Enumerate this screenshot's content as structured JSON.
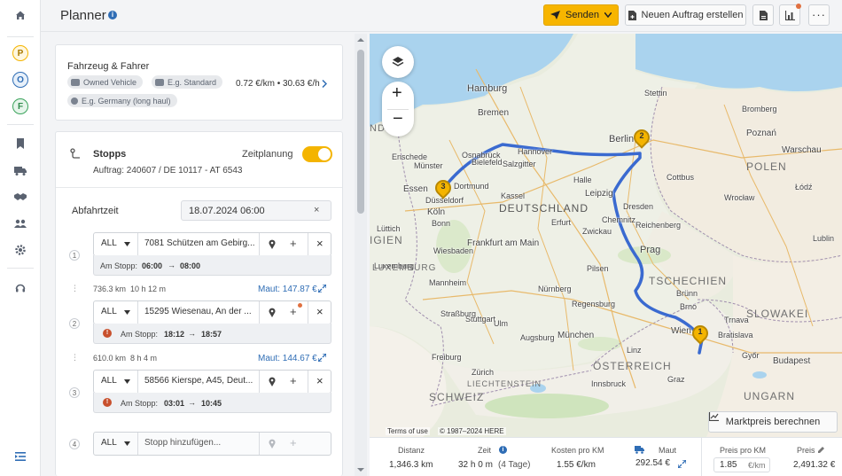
{
  "header": {
    "title": "Planner",
    "send_label": "Senden",
    "new_order_label": "Neuen Auftrag erstellen"
  },
  "rail": {
    "badges": [
      {
        "letter": "P",
        "color": "#f4b400"
      },
      {
        "letter": "O",
        "color": "#2f6db5"
      },
      {
        "letter": "F",
        "color": "#3aa35b"
      }
    ]
  },
  "vehicle": {
    "title": "Fahrzeug & Fahrer",
    "chips": [
      "Owned Vehicle",
      "E.g. Standard",
      "E.g. Germany (long haul)"
    ],
    "rate": "0.72 €/km • 30.63 €/h"
  },
  "stops": {
    "title": "Stopps",
    "order_ref": "Auftrag: 240607 / DE 10117 - AT 6543",
    "time_planning_label": "Zeitplanung",
    "departure_label": "Abfahrtzeit",
    "departure_value": "18.07.2024 06:00",
    "items": [
      {
        "num": "1",
        "filter": "ALL",
        "address": "7081 Schützen am Gebirg...",
        "at_stop_label": "Am Stopp:",
        "from": "06:00",
        "to": "08:00",
        "warning": false
      },
      {
        "num": "2",
        "filter": "ALL",
        "address": "15295 Wiesenau, An der ...",
        "at_stop_label": "Am Stopp:",
        "from": "18:12",
        "to": "18:57",
        "warning": true
      },
      {
        "num": "3",
        "filter": "ALL",
        "address": "58566 Kierspe, A45, Deut...",
        "at_stop_label": "Am Stopp:",
        "from": "03:01",
        "to": "10:45",
        "warning": true
      },
      {
        "num": "4",
        "filter": "ALL",
        "address": "Stopp hinzufügen..."
      }
    ],
    "legs": [
      {
        "distance": "736.3 km",
        "duration": "10 h 12 m",
        "toll": "Maut: 147.87 €"
      },
      {
        "distance": "610.0 km",
        "duration": "8 h 4 m",
        "toll": "Maut: 144.67 €"
      }
    ]
  },
  "map": {
    "cities": [
      "Hamburg",
      "Bremen",
      "Berlin",
      "Stettin",
      "Hannover",
      "Bielefeld",
      "Dortmund",
      "Essen",
      "Köln",
      "Düsseldorf",
      "Bonn",
      "Münster",
      "Osnabrück",
      "Enschede",
      "Kassel",
      "Leipzig",
      "Dresden",
      "Erfurt",
      "Frankfurt am Main",
      "Wiesbaden",
      "Mannheim",
      "Nürnberg",
      "Stuttgart",
      "Straßburg",
      "München",
      "Prag",
      "Brünn",
      "Wien",
      "Bratislava",
      "Budapest",
      "Graz",
      "Linz",
      "Cottbus",
      "Poznań",
      "Wrocław",
      "Warschau",
      "Łódź",
      "Bromberg",
      "Lublin",
      "Salzgitter",
      "Halle",
      "Chemnitz",
      "Zwickau",
      "Reichenberg",
      "Pilsen",
      "Regensburg",
      "Augsburg",
      "Ulm",
      "Freiburg",
      "Zürich",
      "Innsbruck",
      "Luxemburg",
      "Lüttich",
      "Brno",
      "Győr",
      "Trnava"
    ],
    "countries": [
      "NDE",
      "DEUTSCHLAND",
      "POLEN",
      "TSCHECHIEN",
      "SLOWAKEI",
      "ÖSTERREICH",
      "LIECHTENSTEIN",
      "SCHWEIZ",
      "UNGARN",
      "LUXEMBURG",
      "IGIEN"
    ],
    "terms": "Terms of use",
    "copyright": "© 1987–2024 HERE",
    "market_price_label": "Marktpreis berechnen",
    "pins": [
      "1",
      "2",
      "3"
    ]
  },
  "stats": {
    "distance_label": "Distanz",
    "distance_value": "1,346.3 km",
    "time_label": "Zeit",
    "time_value": "32 h 0 m",
    "time_days": "(4 Tage)",
    "cost_label": "Kosten pro KM",
    "cost_value": "1.55 €/km",
    "toll_label": "Maut",
    "toll_value": "292.54 €",
    "price_per_km_label": "Preis pro KM",
    "price_per_km_value": "1.85",
    "price_per_km_unit": "€/km",
    "price_label": "Preis",
    "price_value": "2,491.32 €"
  }
}
